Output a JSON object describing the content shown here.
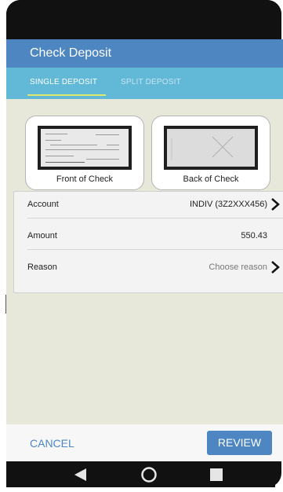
{
  "app": {
    "title": "Check Deposit"
  },
  "tabs": [
    {
      "label": "SINGLE DEPOSIT",
      "active": true
    },
    {
      "label": "SPLIT DEPOSIT",
      "active": false
    }
  ],
  "check_cards": [
    {
      "label": "Front of Check"
    },
    {
      "label": "Back of Check"
    }
  ],
  "details": [
    {
      "label": "Account",
      "value": "INDIV (3Z2XXX456)"
    },
    {
      "label": "Amount",
      "value": "550.43"
    },
    {
      "label": "Reason",
      "value": "Choose reason"
    }
  ],
  "actions": {
    "cancel": "CANCEL",
    "review": "REVIEW"
  },
  "colors": {
    "primary": "#4d86c0",
    "tab_bar": "#62b8d7",
    "tab_indicator": "#dfe76c",
    "background": "#e7e8da"
  },
  "icons": [
    "chevron-right-icon",
    "back-icon",
    "home-icon",
    "recents-icon"
  ]
}
